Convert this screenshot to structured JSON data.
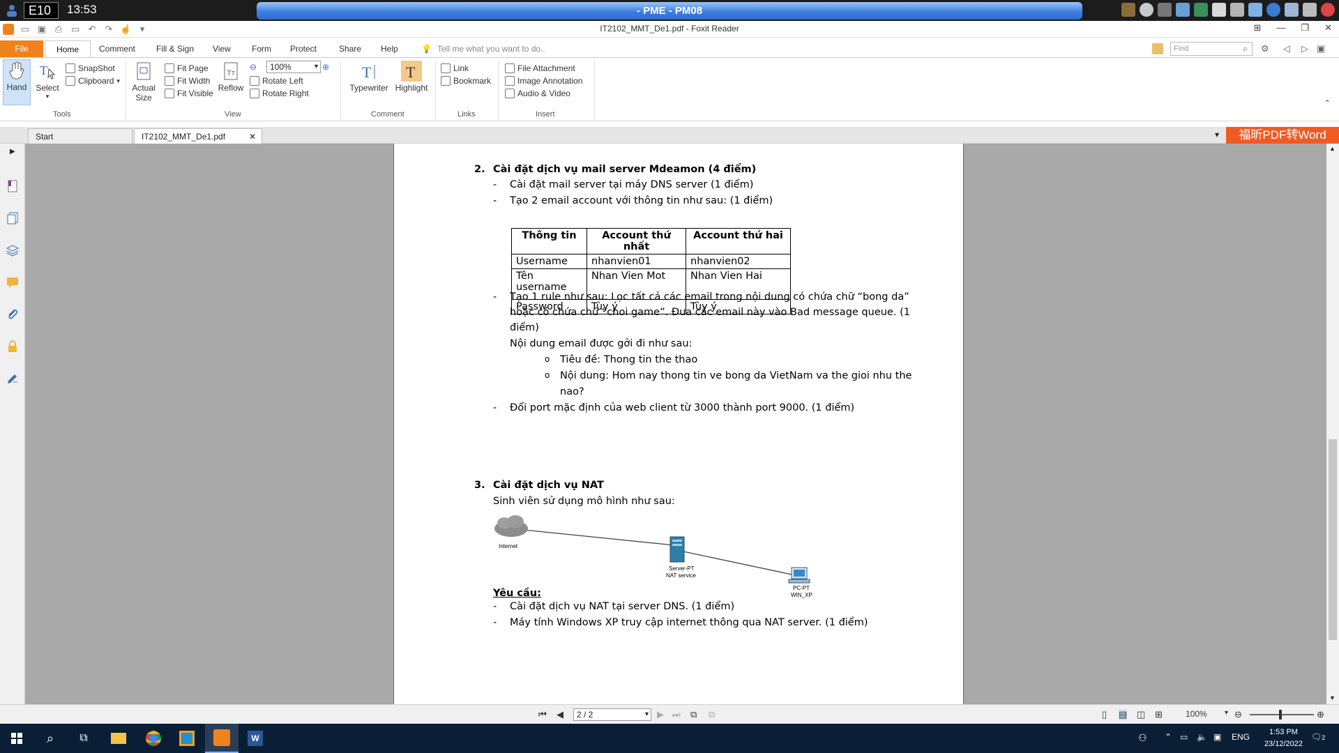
{
  "banner": {
    "label": "E10",
    "time": "13:53",
    "title": "- PME - PM08"
  },
  "window": {
    "title": "IT2102_MMT_De1.pdf - Foxit Reader"
  },
  "menu": {
    "tabs": [
      "File",
      "Home",
      "Comment",
      "Fill & Sign",
      "View",
      "Form",
      "Protect",
      "Share",
      "Help"
    ],
    "tell_me": "Tell me what you want to do..",
    "find_placeholder": "Find"
  },
  "ribbon": {
    "tools": {
      "hand": "Hand",
      "select": "Select",
      "snapshot": "SnapShot",
      "clipboard": "Clipboard",
      "label": "Tools"
    },
    "view": {
      "actual_size": "Actual Size",
      "fit_page": "Fit Page",
      "fit_width": "Fit Width",
      "fit_visible": "Fit Visible",
      "reflow": "Reflow",
      "zoom": "100%",
      "rotate_left": "Rotate Left",
      "rotate_right": "Rotate Right",
      "label": "View"
    },
    "comment": {
      "typewriter": "Typewriter",
      "highlight": "Highlight",
      "label": "Comment"
    },
    "links": {
      "link": "Link",
      "bookmark": "Bookmark",
      "label": "Links"
    },
    "insert": {
      "file_attachment": "File Attachment",
      "image_annotation": "Image Annotation",
      "audio_video": "Audio & Video",
      "label": "Insert"
    }
  },
  "doc_tabs": {
    "start": "Start",
    "file": "IT2102_MMT_De1.pdf",
    "promo": "福昕PDF转Word"
  },
  "doc": {
    "s2_num": "2.",
    "s2_title": "Cài đặt dịch vụ mail server Mdeamon (4 điểm)",
    "s2_b1": "Cài đặt mail server tại máy DNS server (1 điểm)",
    "s2_b2": "Tạo 2 email account với thông tin như sau: (1 điểm)",
    "table": {
      "headers": [
        "Thông tin",
        "Account thứ nhất",
        "Account thứ hai"
      ],
      "rows": [
        [
          "Username",
          "nhanvien01",
          "nhanvien02"
        ],
        [
          "Tên username",
          "Nhan Vien Mot",
          "Nhan Vien Hai"
        ],
        [
          "Password",
          "Tùy ý",
          "Tùy ý"
        ]
      ]
    },
    "s2_b3_l1": "Tạo 1 rule như sau: Lọc tất cả các email trong nội dung có chứa chữ “bong da”",
    "s2_b3_l2": "hoặc có chứa chữ “choi game”. Đưa các email này vào Bad message queue. (1",
    "s2_b3_l3": "điểm)",
    "s2_b3_l4": "Nội dung email được gởi đi như sau:",
    "s2_sub1": "Tiêu đề: Thong tin the thao",
    "s2_sub2_l1": "Nội dung: Hom nay thong tin ve bong da VietNam va the gioi nhu the",
    "s2_sub2_l2": "nao?",
    "s2_b4": "Đổi port mặc định của web client từ 3000 thành port 9000. (1 điểm)",
    "s3_num": "3.",
    "s3_title": "Cài đặt dịch vụ NAT",
    "s3_intro": "Sinh viên sử dụng mô hình như sau:",
    "diagram": {
      "internet": "Internet",
      "server_l1": "Server-PT",
      "server_l2": "NAT service",
      "pc_l1": "PC-PT",
      "pc_l2": "WIN_XP"
    },
    "req_title": "Yêu cầu:",
    "req_b1": "Cài đặt dịch vụ NAT tại server DNS. (1 điểm)",
    "req_b2": "Máy tính Windows XP truy cập internet thông qua NAT server. (1 điểm)",
    "dash": "-",
    "circle": "o"
  },
  "pagebar": {
    "page": "2 / 2",
    "zoom": "100%"
  },
  "taskbar": {
    "lang": "ENG",
    "time": "1:53 PM",
    "date": "23/12/2022",
    "notif": "2"
  }
}
